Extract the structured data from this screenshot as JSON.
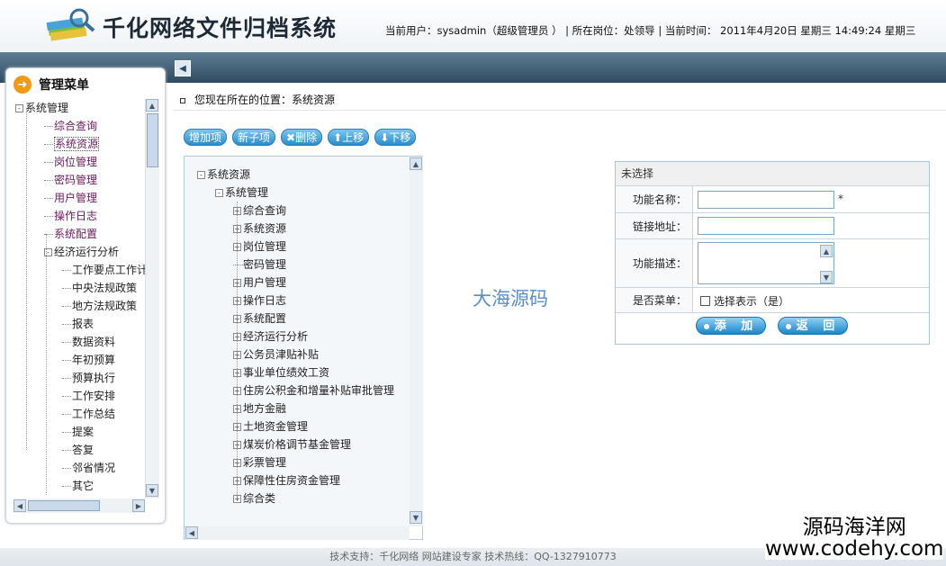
{
  "app": {
    "title": "千化网络文件归档系统"
  },
  "header": {
    "user_label": "当前用户：",
    "user_value": "sysadmin（超级管理员 ）",
    "sep1": "|",
    "position_label": "所在岗位：",
    "position_value": "处领导",
    "sep2": "|",
    "time_label": "当前时间：",
    "time_value": "2011年4月20日 星期三 14:49:24 星期三"
  },
  "sidebar": {
    "title": "管理菜单",
    "items": [
      {
        "label": "系统管理",
        "level": 0,
        "toggle": "-"
      },
      {
        "label": "综合查询",
        "level": 1,
        "toggle": ""
      },
      {
        "label": "系统资源",
        "level": 1,
        "toggle": "",
        "active": true
      },
      {
        "label": "岗位管理",
        "level": 1,
        "toggle": ""
      },
      {
        "label": "密码管理",
        "level": 1,
        "toggle": ""
      },
      {
        "label": "用户管理",
        "level": 1,
        "toggle": ""
      },
      {
        "label": "操作日志",
        "level": 1,
        "toggle": ""
      },
      {
        "label": "系统配置",
        "level": 1,
        "toggle": ""
      },
      {
        "label": "经济运行分析",
        "level": 1,
        "toggle": "-"
      },
      {
        "label": "工作要点工作计划",
        "level": 2,
        "toggle": ""
      },
      {
        "label": "中央法规政策",
        "level": 2,
        "toggle": ""
      },
      {
        "label": "地方法规政策",
        "level": 2,
        "toggle": ""
      },
      {
        "label": "报表",
        "level": 2,
        "toggle": ""
      },
      {
        "label": "数据资料",
        "level": 2,
        "toggle": ""
      },
      {
        "label": "年初预算",
        "level": 2,
        "toggle": ""
      },
      {
        "label": "预算执行",
        "level": 2,
        "toggle": ""
      },
      {
        "label": "工作安排",
        "level": 2,
        "toggle": ""
      },
      {
        "label": "工作总结",
        "level": 2,
        "toggle": ""
      },
      {
        "label": "提案",
        "level": 2,
        "toggle": ""
      },
      {
        "label": "答复",
        "level": 2,
        "toggle": ""
      },
      {
        "label": "邻省情况",
        "level": 2,
        "toggle": ""
      },
      {
        "label": "其它",
        "level": 2,
        "toggle": ""
      }
    ]
  },
  "breadcrumb": {
    "text": "您现在所在的位置：系统资源"
  },
  "toolbar": {
    "add": "增加项",
    "add_child": "新子项",
    "delete": "删除",
    "move_up": "上移",
    "move_down": "下移"
  },
  "resource_tree": [
    {
      "label": "系统资源",
      "level": 0,
      "toggle": "-"
    },
    {
      "label": "系统管理",
      "level": 1,
      "toggle": "-"
    },
    {
      "label": "综合查询",
      "level": 2,
      "toggle": "+"
    },
    {
      "label": "系统资源",
      "level": 2,
      "toggle": "+"
    },
    {
      "label": "岗位管理",
      "level": 2,
      "toggle": "+"
    },
    {
      "label": "密码管理",
      "level": 2,
      "toggle": ""
    },
    {
      "label": "用户管理",
      "level": 2,
      "toggle": "+"
    },
    {
      "label": "操作日志",
      "level": 2,
      "toggle": "+"
    },
    {
      "label": "系统配置",
      "level": 2,
      "toggle": "+"
    },
    {
      "label": "经济运行分析",
      "level": 2,
      "toggle": "+"
    },
    {
      "label": "公务员津贴补贴",
      "level": 2,
      "toggle": "+"
    },
    {
      "label": "事业单位绩效工资",
      "level": 2,
      "toggle": "+"
    },
    {
      "label": "住房公积金和增量补贴审批管理",
      "level": 2,
      "toggle": "+"
    },
    {
      "label": "地方金融",
      "level": 2,
      "toggle": "+"
    },
    {
      "label": "土地资金管理",
      "level": 2,
      "toggle": "+"
    },
    {
      "label": "煤炭价格调节基金管理",
      "level": 2,
      "toggle": "+"
    },
    {
      "label": "彩票管理",
      "level": 2,
      "toggle": "+"
    },
    {
      "label": "保障性住房资金管理",
      "level": 2,
      "toggle": "+"
    },
    {
      "label": "综合类",
      "level": 2,
      "toggle": "+"
    }
  ],
  "watermark": "大海源码",
  "form": {
    "title": "未选择",
    "name_label": "功能名称：",
    "name_value": "",
    "required_mark": "*",
    "url_label": "链接地址：",
    "url_value": "",
    "desc_label": "功能描述：",
    "desc_value": "",
    "menu_label": "是否菜单：",
    "menu_checkbox_label": "选择表示（是）",
    "add_button": "添 加",
    "back_button": "返 回"
  },
  "footer": {
    "text": "技术支持：千化网络   网站建设专家    技术热线：QQ-1327910773"
  },
  "corner_watermark": {
    "line1": "源码海洋网",
    "line2": "www.codehy.com"
  }
}
